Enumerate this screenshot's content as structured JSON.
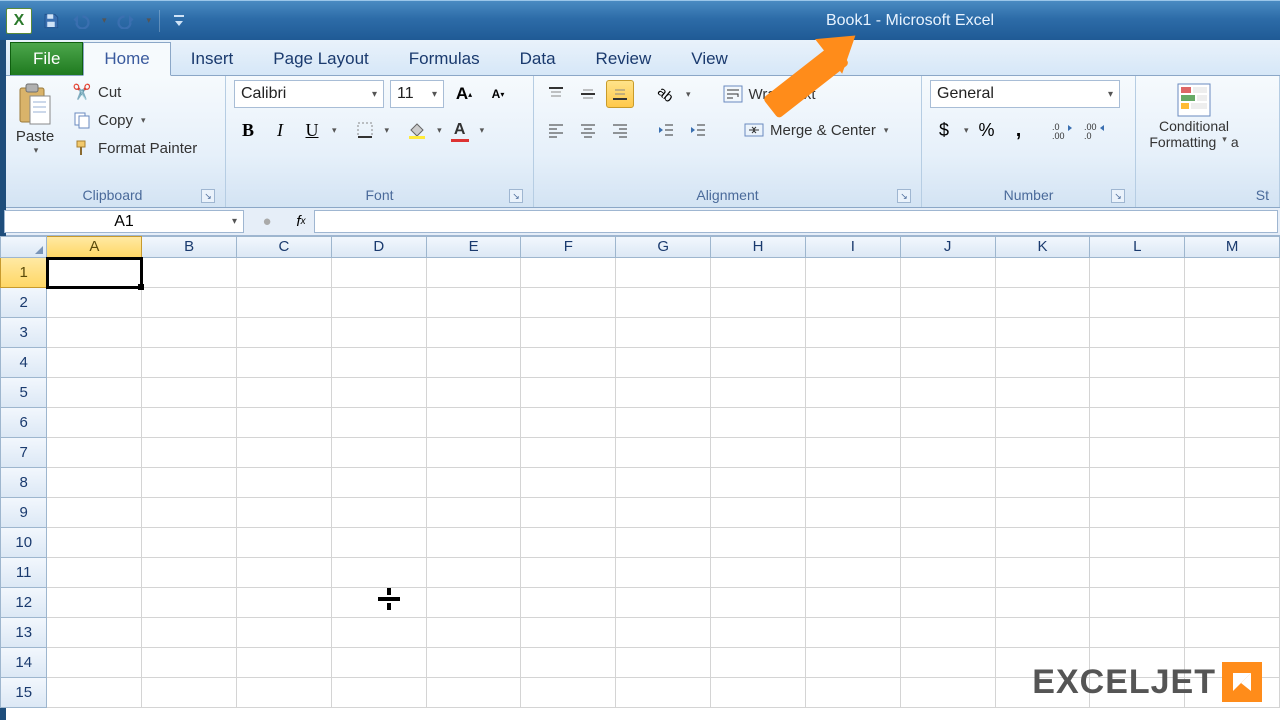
{
  "title": "Book1  -  Microsoft Excel",
  "qat": {
    "logo": "X"
  },
  "tabs": {
    "file": "File",
    "items": [
      "Home",
      "Insert",
      "Page Layout",
      "Formulas",
      "Data",
      "Review",
      "View"
    ],
    "active": "Home"
  },
  "clipboard": {
    "paste": "Paste",
    "cut": "Cut",
    "copy": "Copy",
    "format_painter": "Format Painter",
    "label": "Clipboard"
  },
  "font": {
    "name": "Calibri",
    "size": "11",
    "label": "Font"
  },
  "alignment": {
    "wrap": "Wrap Text",
    "merge": "Merge & Center",
    "label": "Alignment"
  },
  "number": {
    "format": "General",
    "label": "Number"
  },
  "styles": {
    "cond_l1": "Conditional",
    "cond_l2": "Formatting",
    "label": "St",
    "and": "a"
  },
  "namebox": "A1",
  "columns": [
    "A",
    "B",
    "C",
    "D",
    "E",
    "F",
    "G",
    "H",
    "I",
    "J",
    "K",
    "L",
    "M"
  ],
  "rows": [
    "1",
    "2",
    "3",
    "4",
    "5",
    "6",
    "7",
    "8",
    "9",
    "10",
    "11",
    "12",
    "13",
    "14",
    "15"
  ],
  "active_col": "A",
  "active_row": "1",
  "watermark": "EXCELJET",
  "number_btns": {
    "currency": "$",
    "percent": "%",
    "comma": ",",
    "inc": ".00",
    "dec": ".0"
  }
}
